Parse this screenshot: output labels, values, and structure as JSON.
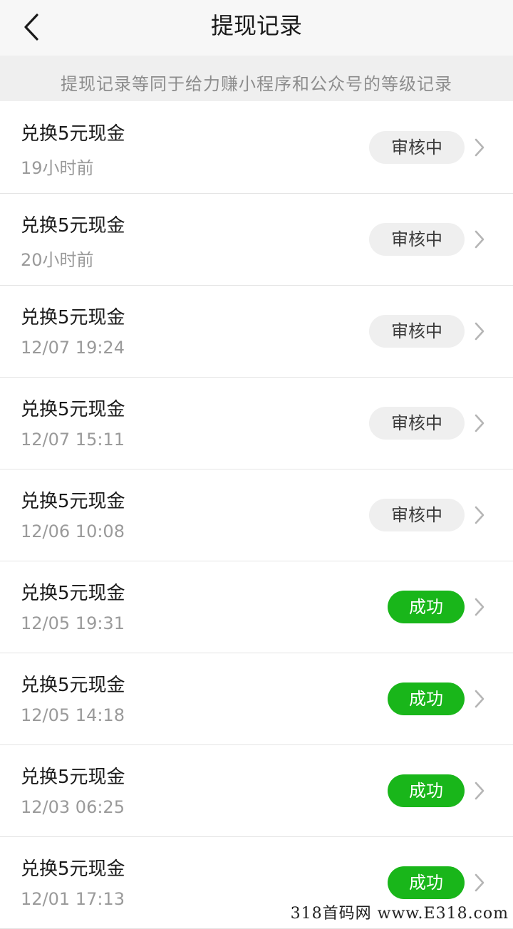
{
  "header": {
    "title": "提现记录",
    "back_icon": "chevron-left-icon"
  },
  "notice": {
    "text": "提现记录等同于给力赚小程序和公众号的等级记录"
  },
  "records": [
    {
      "title": "兑换5元现金",
      "time": "19小时前",
      "status": "审核中",
      "status_type": "pending"
    },
    {
      "title": "兑换5元现金",
      "time": "20小时前",
      "status": "审核中",
      "status_type": "pending"
    },
    {
      "title": "兑换5元现金",
      "time": "12/07 19:24",
      "status": "审核中",
      "status_type": "pending"
    },
    {
      "title": "兑换5元现金",
      "time": "12/07 15:11",
      "status": "审核中",
      "status_type": "pending"
    },
    {
      "title": "兑换5元现金",
      "time": "12/06 10:08",
      "status": "审核中",
      "status_type": "pending"
    },
    {
      "title": "兑换5元现金",
      "time": "12/05 19:31",
      "status": "成功",
      "status_type": "success"
    },
    {
      "title": "兑换5元现金",
      "time": "12/05 14:18",
      "status": "成功",
      "status_type": "success"
    },
    {
      "title": "兑换5元现金",
      "time": "12/03 06:25",
      "status": "成功",
      "status_type": "success"
    },
    {
      "title": "兑换5元现金",
      "time": "12/01 17:13",
      "status": "成功",
      "status_type": "success"
    }
  ],
  "watermark": {
    "text": "318首码网  www.E318.com"
  },
  "colors": {
    "success": "#19b61a",
    "pending_bg": "#efefef",
    "notice_bg": "#efefef"
  }
}
